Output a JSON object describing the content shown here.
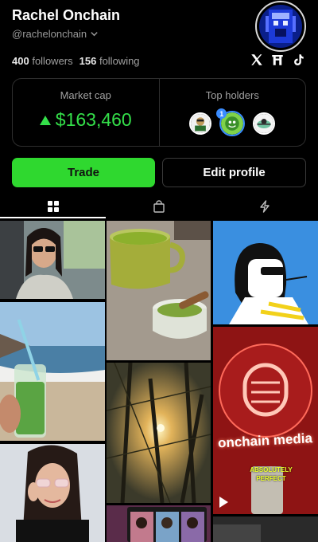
{
  "profile": {
    "name": "Rachel Onchain",
    "handle": "@rachelonchain",
    "followers_count": "400",
    "followers_label": "followers",
    "following_count": "156",
    "following_label": "following"
  },
  "socials": [
    "x-icon",
    "linktree-icon",
    "tiktok-icon"
  ],
  "stats_card": {
    "market_cap_label": "Market cap",
    "market_cap_value": "$163,460",
    "top_holders_label": "Top holders",
    "top_holder_rank": "1"
  },
  "actions": {
    "trade_label": "Trade",
    "edit_label": "Edit profile"
  },
  "tabs": [
    "grid-icon",
    "shopping-bag-icon",
    "lightning-icon"
  ],
  "media_tiles": [
    {
      "name": "media-selfie-car",
      "type": "photo"
    },
    {
      "name": "media-matcha-mug",
      "type": "photo"
    },
    {
      "name": "media-cartoon-drawing",
      "type": "photo"
    },
    {
      "name": "media-matcha-beach",
      "type": "photo"
    },
    {
      "name": "media-forest-sun",
      "type": "photo"
    },
    {
      "name": "media-onchain-media-neon",
      "type": "video",
      "neon_text": "onchain media",
      "sticker_text": "ABSOLUTELY PERFECT"
    },
    {
      "name": "media-glasses-portrait",
      "type": "photo"
    },
    {
      "name": "media-video-call",
      "type": "photo"
    }
  ],
  "colors": {
    "accent_green": "#2fd82f",
    "market_cap_green": "#34e04a",
    "rank_blue": "#3a8cff"
  }
}
